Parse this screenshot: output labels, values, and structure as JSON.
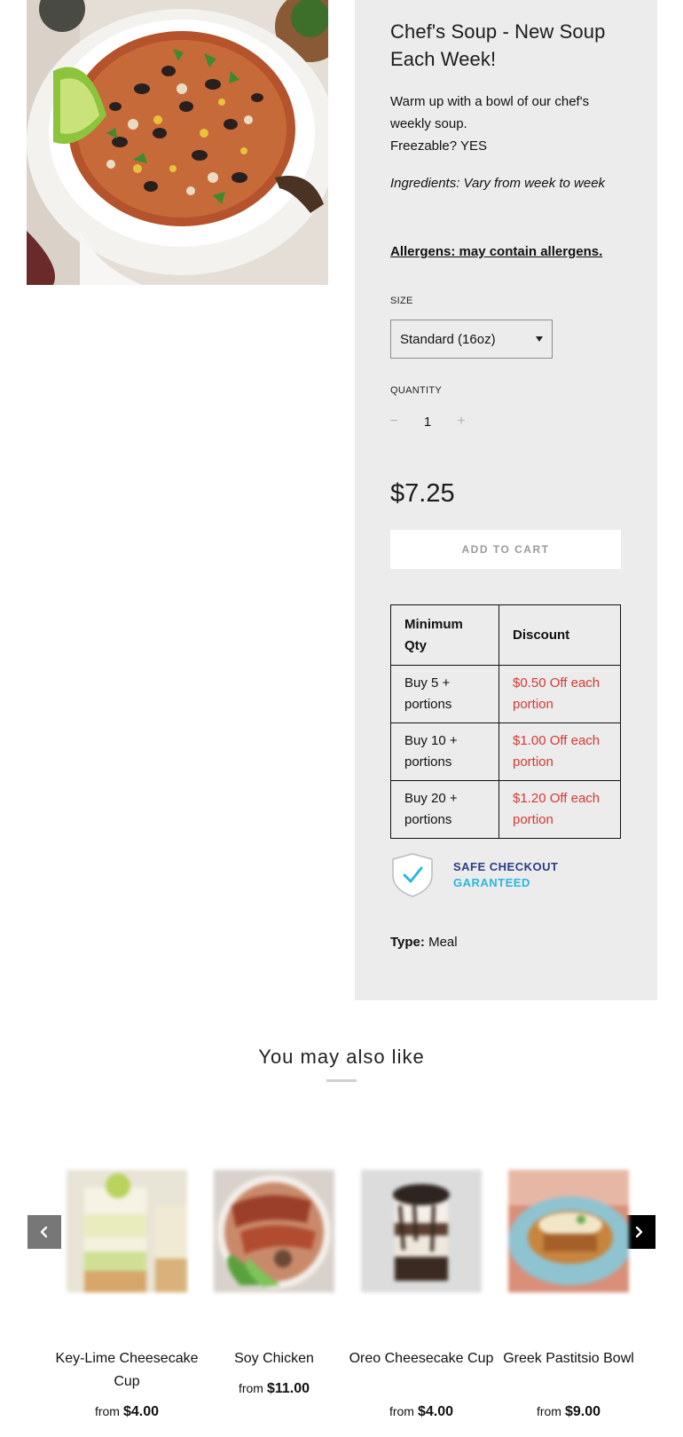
{
  "product": {
    "title": "Chef's Soup - New Soup Each Week!",
    "description_line1": "Warm up with a bowl of our chef's weekly soup.",
    "description_line2": "Freezable? YES",
    "ingredients": "Ingredients: Vary from week to week",
    "allergens": "Allergens: may contain allergens.",
    "size_label": "SIZE",
    "size_selected": "Standard (16oz)",
    "quantity_label": "QUANTITY",
    "quantity_value": "1",
    "quantity_minus": "−",
    "quantity_plus": "+",
    "price": "$7.25",
    "add_to_cart_label": "ADD TO CART",
    "type_label": "Type:",
    "type_value": "Meal",
    "image_icon": "soup-bowl-image"
  },
  "discount_table": {
    "header_qty": "Minimum Qty",
    "header_discount": "Discount",
    "rows": [
      {
        "qty": "Buy 5 + portions",
        "discount": "$0.50 Off each portion"
      },
      {
        "qty": "Buy 10 + portions",
        "discount": "$1.00 Off each portion"
      },
      {
        "qty": "Buy 20 + portions",
        "discount": "$1.20 Off each portion"
      }
    ],
    "discount_color": "#d43a32"
  },
  "safe_checkout": {
    "line1": "SAFE CHECKOUT",
    "line2": "GARANTEED",
    "icon": "shield-check-icon",
    "color_primary": "#2c3c86",
    "color_accent": "#2ab7de"
  },
  "related": {
    "title": "You may also like",
    "prev_icon": "chevron-left-icon",
    "next_icon": "chevron-right-icon",
    "items": [
      {
        "name": "Key-Lime Cheesecake Cup",
        "from": "from",
        "price": "$4.00"
      },
      {
        "name": "Soy Chicken",
        "from": "from",
        "price": "$11.00"
      },
      {
        "name": "Oreo Cheesecake Cup",
        "from": "from",
        "price": "$4.00"
      },
      {
        "name": "Greek Pastitsio Bowl",
        "from": "from",
        "price": "$9.00"
      }
    ]
  },
  "colors": {
    "panel_bg": "#ececec",
    "price_text": "#1c1c1c",
    "next_button": "#000000",
    "prev_button": "#777777"
  }
}
